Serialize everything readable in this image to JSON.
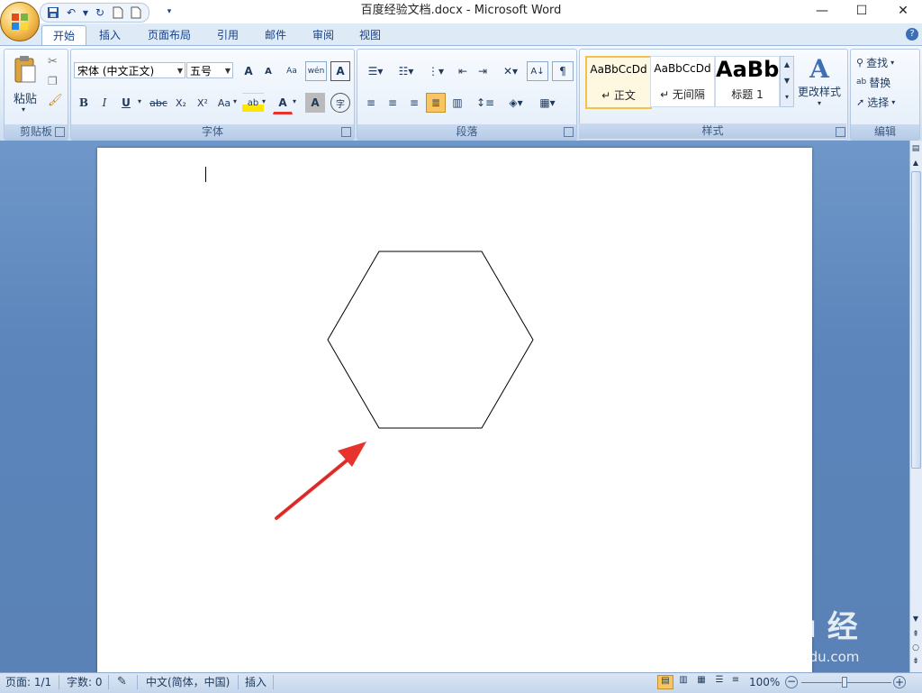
{
  "window": {
    "title": "百度经验文档.docx - Microsoft Word",
    "minimize": "—",
    "maximize": "☐",
    "close": "✕"
  },
  "tabs": [
    "开始",
    "插入",
    "页面布局",
    "引用",
    "邮件",
    "审阅",
    "视图"
  ],
  "ribbon": {
    "clipboard": {
      "label": "剪贴板",
      "paste": "粘贴"
    },
    "font": {
      "label": "字体",
      "font_name": "宋体 (中文正文)",
      "font_size": "五号",
      "bold": "B",
      "italic": "I",
      "underline": "U",
      "strike": "abc",
      "subscript": "X₂",
      "superscript": "X²",
      "change_case": "Aa",
      "grow": "A",
      "shrink": "A",
      "phonetic": "wén",
      "char_border": "A",
      "char_shading": "A",
      "enclose": "字",
      "font_color": "A",
      "highlight": "ab"
    },
    "paragraph": {
      "label": "段落"
    },
    "styles": {
      "label": "样式",
      "items": [
        {
          "sample": "AaBbCcDd",
          "name": "↵ 正文"
        },
        {
          "sample": "AaBbCcDd",
          "name": "↵ 无间隔"
        },
        {
          "sample": "AaBb",
          "name": "标题 1"
        }
      ],
      "change_styles": "更改样式"
    },
    "editing": {
      "label": "编辑",
      "find": "查找",
      "replace": "替换",
      "select": "选择"
    }
  },
  "statusbar": {
    "page": "页面: 1/1",
    "words": "字数: 0",
    "language": "中文(简体，中国)",
    "mode": "插入",
    "zoom": "100%"
  },
  "watermark": {
    "brand": "Bai du 经验",
    "site": "jingyan.baidu.com"
  },
  "colors": {
    "accent": "#15428b",
    "arrow": "#e8322e",
    "highlight_active": "#f9c560"
  }
}
